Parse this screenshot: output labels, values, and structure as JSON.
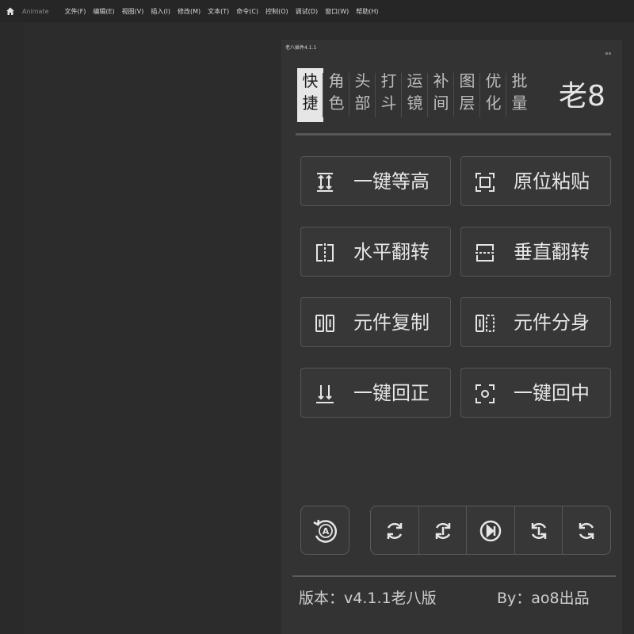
{
  "app": {
    "name": "Animate",
    "menu": [
      "文件(F)",
      "编辑(E)",
      "视图(V)",
      "插入(I)",
      "修改(M)",
      "文本(T)",
      "命令(C)",
      "控制(O)",
      "调试(D)",
      "窗口(W)",
      "帮助(H)"
    ]
  },
  "panel": {
    "title": "老八插件4.1.1",
    "brand": "老8",
    "tabs": [
      {
        "label": "快捷",
        "active": true
      },
      {
        "label": "角色",
        "active": false
      },
      {
        "label": "头部",
        "active": false
      },
      {
        "label": "打斗",
        "active": false
      },
      {
        "label": "运镜",
        "active": false
      },
      {
        "label": "补间",
        "active": false
      },
      {
        "label": "图层",
        "active": false
      },
      {
        "label": "优化",
        "active": false
      },
      {
        "label": "批量",
        "active": false
      }
    ],
    "actions": [
      {
        "label": "一键等高",
        "icon": "equal-height-icon"
      },
      {
        "label": "原位粘贴",
        "icon": "paste-in-place-icon"
      },
      {
        "label": "水平翻转",
        "icon": "flip-horizontal-icon"
      },
      {
        "label": "垂直翻转",
        "icon": "flip-vertical-icon"
      },
      {
        "label": "元件复制",
        "icon": "symbol-duplicate-icon"
      },
      {
        "label": "元件分身",
        "icon": "symbol-split-icon"
      },
      {
        "label": "一键回正",
        "icon": "reset-rotation-icon"
      },
      {
        "label": "一键回中",
        "icon": "center-icon"
      }
    ],
    "auto_button_letter": "A",
    "playback_icons": [
      "rotate-left-icon",
      "rotate-left-half-icon",
      "play-next-frame-icon",
      "rotate-right-half-icon",
      "rotate-right-icon"
    ],
    "version_text": "版本：v4.1.1老八版",
    "author_text": "By：ao8出品"
  },
  "colors": {
    "background": "#2c2c2c",
    "panel": "#333333",
    "active_tab": "#e6e6e6",
    "text": "#e6e6e6"
  }
}
